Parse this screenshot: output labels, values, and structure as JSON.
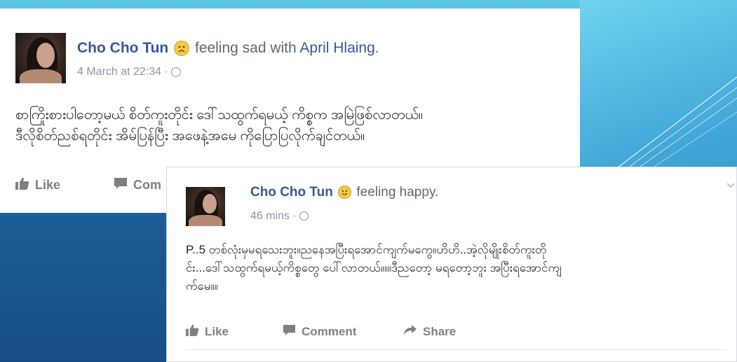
{
  "posts": [
    {
      "author": "Cho Cho Tun",
      "feeling": "feeling sad with",
      "tagged": "April Hlaing",
      "tagged_suffix": ".",
      "emoji": "sad-face-icon",
      "timestamp": "4 March at 22:34",
      "meta_sep": " · ",
      "body": "စာကြိုးစားပါတော့မယ် စိတ်ကူးတိုင်း ဒေါ်သထွက်ရမယ့် ကိစ္စက အမြဲဖြစ်လာတယ်။\nဒီလိုစိတ်ညစ်ရတိုင်း အိမ်ပြန်ပြီး အဖေနဲ့အမေ ကိုပြောပြလိုက်ချင်တယ်။",
      "actions": {
        "like": "Like",
        "comment": "Com"
      }
    },
    {
      "author": "Cho Cho Tun",
      "feeling": "feeling happy.",
      "emoji": "smile-face-icon",
      "timestamp": "46 mins",
      "meta_sep": " · ",
      "body": "P..5 တစ်လုံးမှမရသေးဘူး။ညနေအပြီးရအောင်ကျက်မကွေ။ဟိဟိ..အဲ့လိုမျိုးစိတ်ကူးတို\nင်း...ဒေါ်သထွက်ရမယ့်ကိစ္စတွေ ပေါ်လာတယ်။။။ဒီညတော့ မရတော့ဘူး အပြီးရအောင်ကျ\nက်မေ။။",
      "actions": {
        "like": "Like",
        "comment": "Comment",
        "share": "Share"
      }
    }
  ],
  "colors": {
    "link": "#365899",
    "meta": "#90949c",
    "action": "#7f7f7f",
    "slide_top": "#5cc8e8",
    "slide_bottom": "#174d86"
  }
}
